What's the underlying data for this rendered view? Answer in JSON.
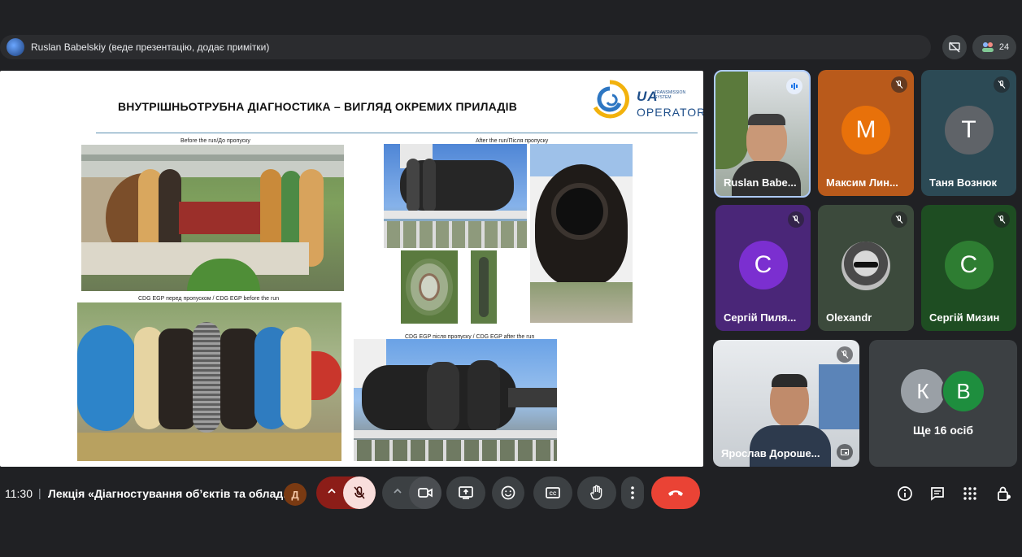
{
  "presenter_bar": {
    "text": "Ruslan Babelskiy (веде презентацію, додає примітки)",
    "participants_count": "24"
  },
  "slide": {
    "title": "ВНУТРІШНЬОТРУБНА ДІАГНОСТИКА – ВИГЛЯД ОКРЕМИХ ПРИЛАДІВ",
    "logo_ua": "UA",
    "logo_small": "TRANSMISSION SYSTEM",
    "logo_operator": "OPERATOR",
    "captions": {
      "before": "Before the run/До пропуску",
      "after": "After the run/Після пропуску",
      "cdg_before": "CDG EGP перед пропуском  / CDG EGP before the run",
      "cdg_after": "CDG EGP після пропуску  / CDG EGP after the run"
    }
  },
  "participants": [
    {
      "name": "Ruslan Babe...",
      "initial": "",
      "color": "#4b5a45",
      "mic": "speaking"
    },
    {
      "name": "Максим Лин...",
      "initial": "М",
      "color": "#e8710a",
      "mic": "muted"
    },
    {
      "name": "Таня Вознюк",
      "initial": "Т",
      "color": "#5f6368",
      "mic": "muted"
    },
    {
      "name": "Сергій Пиля...",
      "initial": "С",
      "color": "#7b2fd0",
      "mic": "muted"
    },
    {
      "name": "Olexandr",
      "initial": "",
      "color": "#3c4043",
      "mic": "muted"
    },
    {
      "name": "Сергій Мизин",
      "initial": "С",
      "color": "#2e7d32",
      "mic": "muted"
    },
    {
      "name": "Ярослав Дороше...",
      "initial": "",
      "color": "#c9ced3",
      "mic": "muted"
    }
  ],
  "others": {
    "label": "Ще 16 осіб",
    "initials": [
      "К",
      "В"
    ]
  },
  "bottom_bar": {
    "time": "11:30",
    "meeting_title": "Лекція «Діагностування об’єктів та облад...",
    "badge": "Д"
  },
  "colors": {
    "background": "#202124",
    "end_call": "#ea4335",
    "mic_muted_bg": "#f9dedc"
  }
}
